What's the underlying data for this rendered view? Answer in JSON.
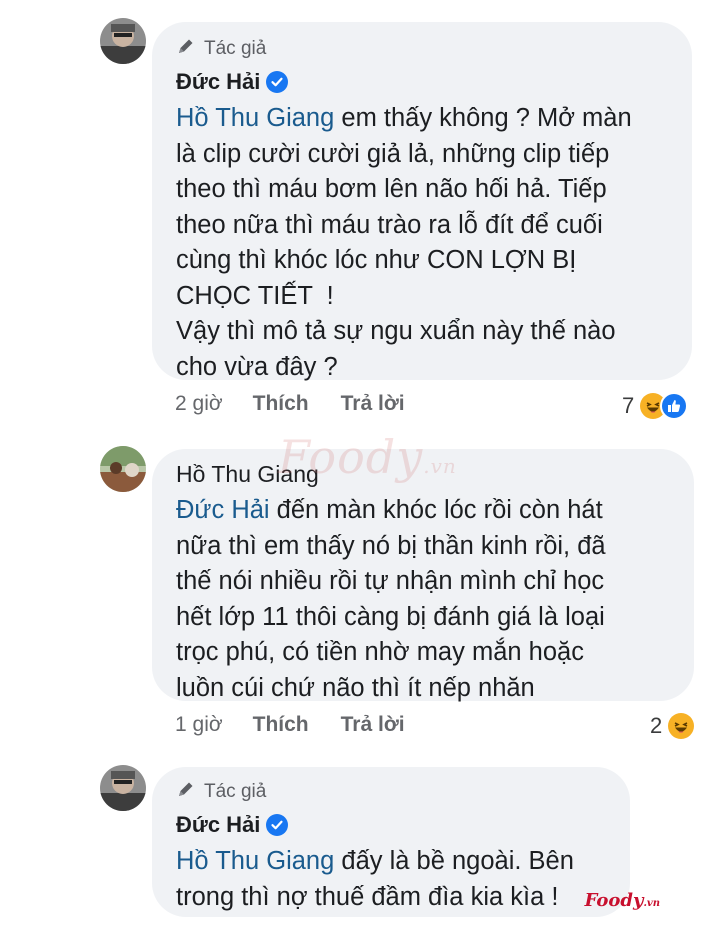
{
  "comments": [
    {
      "author_tag": "Tác giả",
      "name": "Đức Hải",
      "verified": true,
      "mention": "Hồ Thu Giang",
      "body_lines": [
        " em thấy không ? Mở màn",
        "là clip cười cười giả lả, những clip tiếp",
        "theo thì máu bơm lên não hối hả. Tiếp",
        "theo nữa thì máu trào ra lỗ đít để cuối",
        "cùng thì khóc lóc như CON LỢN BỊ",
        "CHỌC TIẾT  !",
        "Vậy thì mô tả sự ngu xuẩn này thế nào",
        "cho vừa đây ?"
      ],
      "time": "2 giờ",
      "like_label": "Thích",
      "reply_label": "Trả lời",
      "reaction_count": "7"
    },
    {
      "name": "Hồ Thu Giang",
      "mention": "Đức Hải",
      "body_lines": [
        " đến màn khóc lóc rồi còn hát",
        "nữa thì em thấy nó bị thần kinh rồi, đã",
        "thế nói nhiều rồi tự nhận mình chỉ học",
        "hết lớp 11 thôi càng bị đánh giá là loại",
        "trọc phú, có tiền nhờ may mắn hoặc",
        "luồn cúi chứ não thì ít nếp nhăn"
      ],
      "time": "1 giờ",
      "like_label": "Thích",
      "reply_label": "Trả lời",
      "reaction_count": "2"
    },
    {
      "author_tag": "Tác giả",
      "name": "Đức Hải",
      "verified": true,
      "mention": "Hồ Thu Giang",
      "body_lines": [
        " đấy là bề ngoài. Bên",
        "trong thì nợ thuế đầm đìa kia kìa !"
      ]
    }
  ],
  "icons": {
    "author": "pencil-icon",
    "verified": "verified-check-icon",
    "haha": "haha-reaction-icon",
    "like": "like-reaction-icon"
  },
  "colors": {
    "bubble": "#f0f2f5",
    "mention": "#1a5b8e",
    "verified": "#1877f2"
  },
  "watermark": {
    "main": "Foody",
    "suffix": ".vn"
  }
}
